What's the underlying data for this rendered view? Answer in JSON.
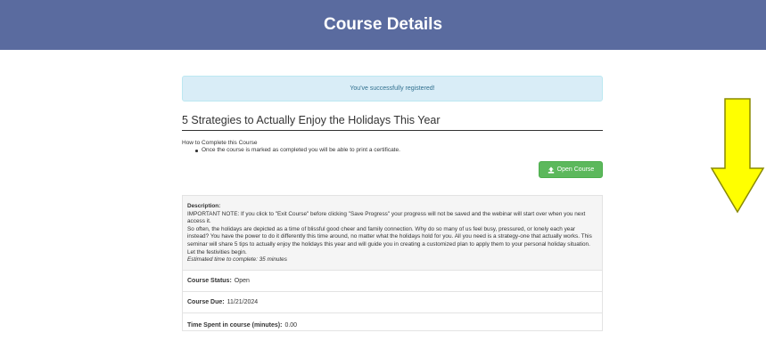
{
  "header": {
    "title": "Course Details"
  },
  "alert": {
    "message": "You've successfully registered!"
  },
  "course": {
    "title": "5 Strategies to Actually Enjoy the Holidays This Year",
    "howto_heading": "How to Complete this Course",
    "howto_items": [
      "Once the course is marked as completed you will be able to print a certificate."
    ],
    "open_button": "Open Course",
    "open_icon": "upload-icon"
  },
  "description": {
    "label": "Description:",
    "note": "IMPORTANT NOTE: If you click to \"Exit Course\" before clicking \"Save Progress\" your progress will not be saved and the webinar will start over when you next access it.",
    "body": "So often, the holidays are depicted as a time of blissful good cheer and family connection. Why do so many of us feel busy, pressured, or lonely each year instead? You have the power to do it differently this time around, no matter what the holidays hold for you. All you need is a strategy-one that actually works. This seminar will share 5 tips to actually enjoy the holidays this year and will guide you in creating a customized plan to apply them to your personal holiday situation. Let the festivities begin.",
    "estimate": "Estimated time to complete: 35 minutes"
  },
  "details": {
    "status_label": "Course Status:",
    "status_value": "Open",
    "due_label": "Course Due:",
    "due_value": "11/21/2024",
    "time_label": "Time Spent in course (minutes):",
    "time_value": "0.00"
  },
  "colors": {
    "header_bg": "#5a6b9f",
    "alert_bg": "#d9edf7",
    "button_bg": "#5cb85c",
    "arrow_fill": "#ffff00"
  },
  "annotation": {
    "icon": "down-arrow-icon"
  }
}
